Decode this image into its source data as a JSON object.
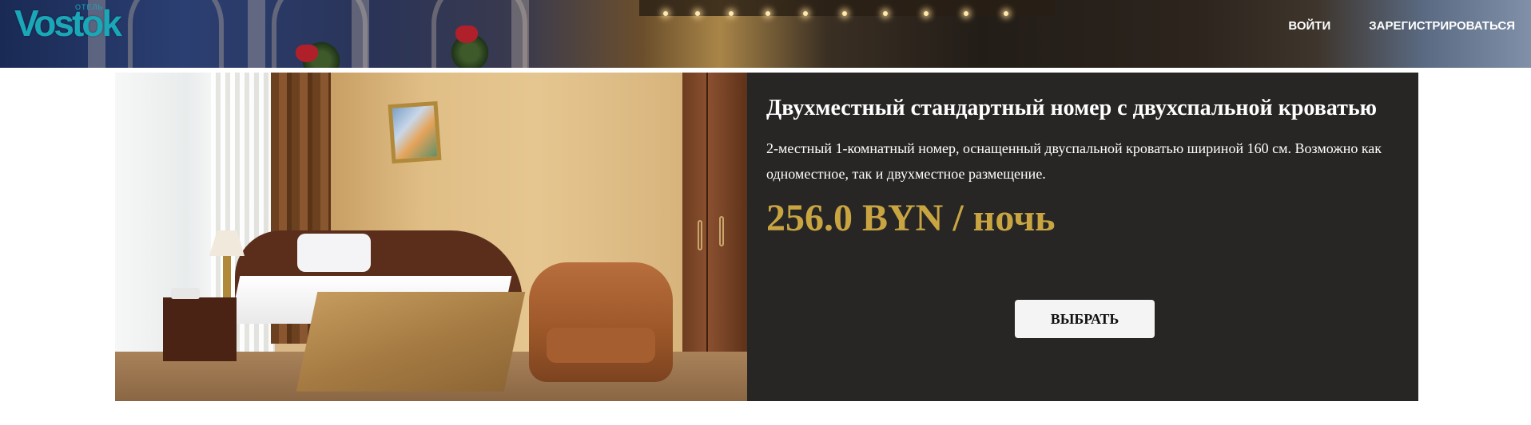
{
  "header": {
    "logo_text": "Vostok",
    "logo_subtext": "ОТЕЛЬ",
    "nav": [
      {
        "label": "ВОЙТИ"
      },
      {
        "label": "ЗАРЕГИСТРИРОВАТЬСЯ"
      }
    ]
  },
  "room": {
    "title": "Двухместный стандартный номер с двухспальной кроватью",
    "description": "2-местный 1-комнатный номер, оснащенный двуспальной кроватью шириной 160 см. Возможно как одноместное, так и двухместное размещение.",
    "price": "256.0 BYN / ночь",
    "button_label": "ВЫБРАТЬ"
  },
  "colors": {
    "logo": "#1aa7b7",
    "panel_bg": "#272625",
    "price": "#c9a542",
    "button_bg": "#f4f4f4"
  }
}
